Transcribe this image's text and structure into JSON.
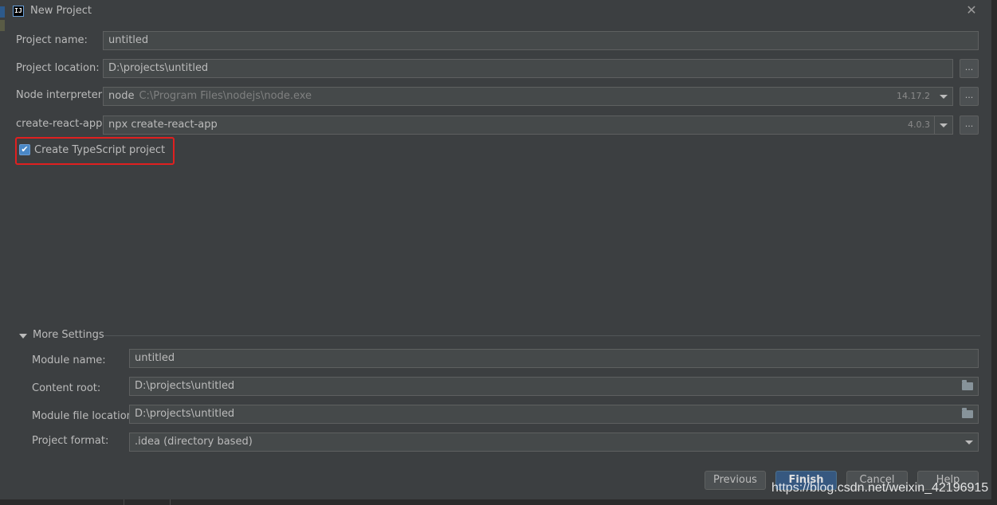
{
  "window": {
    "title": "New Project",
    "app_icon_text": "IJ"
  },
  "form": {
    "project_name": {
      "label": "Project name:",
      "value": "untitled"
    },
    "project_location": {
      "label": "Project location:",
      "value": "D:\\projects\\untitled",
      "browse": "..."
    },
    "node_interpreter": {
      "label": "Node interpreter:",
      "value": "node",
      "path": "C:\\Program Files\\nodejs\\node.exe",
      "version": "14.17.2",
      "browse": "..."
    },
    "create_react_app": {
      "label": "create-react-app:",
      "value": "npx create-react-app",
      "version": "4.0.3",
      "browse": "..."
    },
    "typescript": {
      "label": "Create TypeScript project",
      "checked": true
    }
  },
  "more_settings": {
    "label": "More Settings",
    "module_name": {
      "label": "Module name:",
      "value": "untitled"
    },
    "content_root": {
      "label": "Content root:",
      "value": "D:\\projects\\untitled"
    },
    "module_file_location": {
      "label": "Module file location:",
      "value": "D:\\projects\\untitled"
    },
    "project_format": {
      "label": "Project format:",
      "value": ".idea (directory based)"
    }
  },
  "buttons": {
    "previous": "Previous",
    "finish": "Finish",
    "cancel": "Cancel",
    "help": "Help"
  },
  "watermark": "https://blog.csdn.net/weixin_42196915",
  "colors": {
    "background": "#3c3f41",
    "field": "#45494a",
    "primary": "#365880",
    "highlight": "#e02020",
    "checkbox": "#4a88c7"
  }
}
